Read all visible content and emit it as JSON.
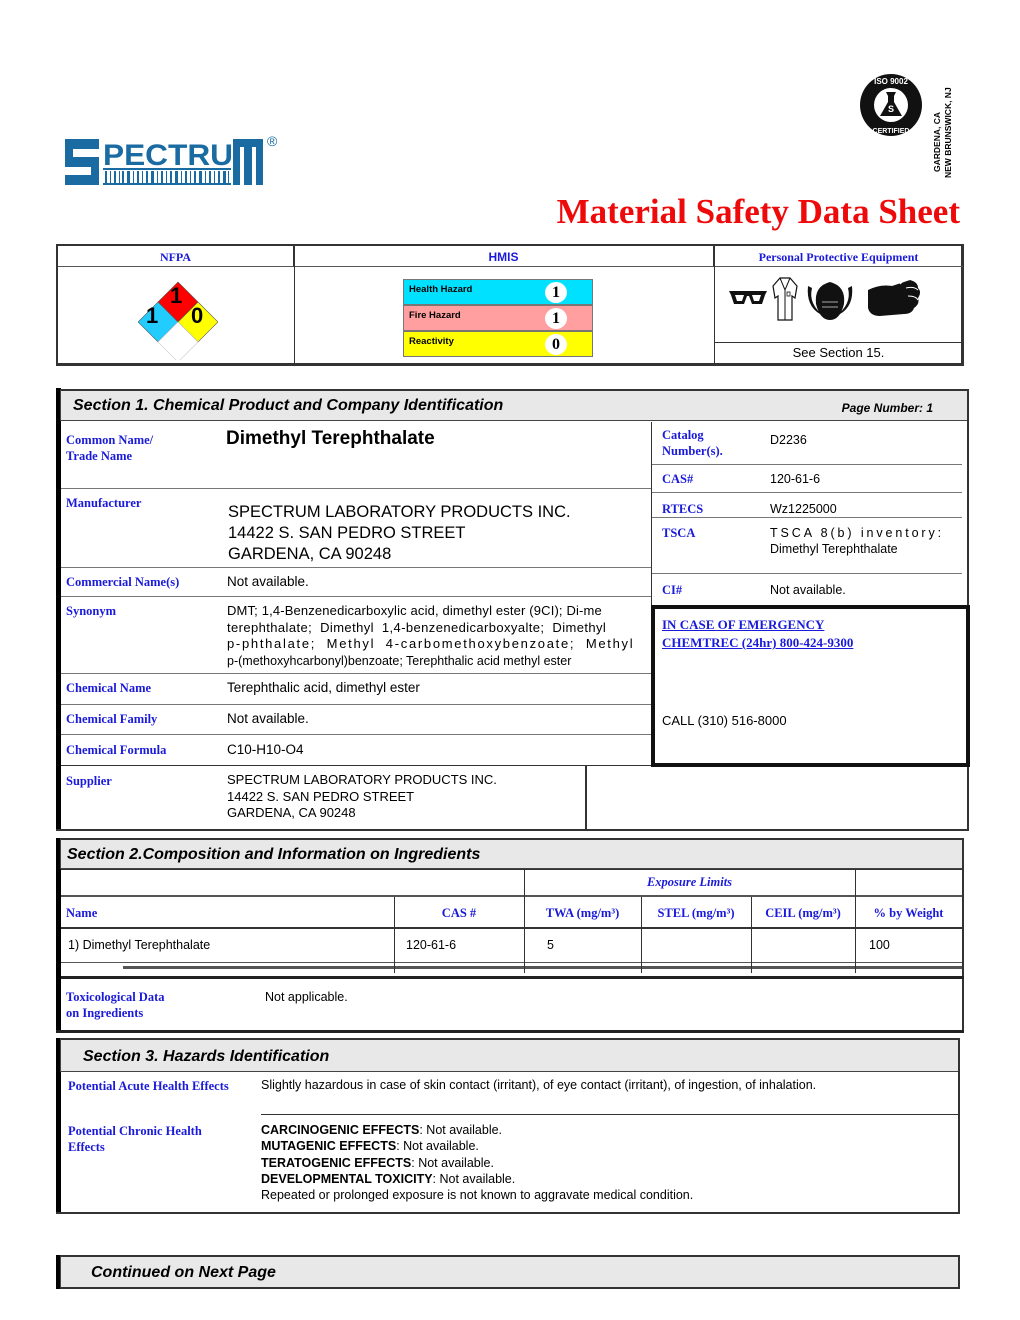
{
  "header": {
    "brand": "SPECTRUM",
    "registered_mark": "®",
    "iso_badge_text": "ISO 9002 CERTIFIED",
    "locations": [
      "GARDENA, CA",
      "NEW BRUNSWICK, NJ"
    ],
    "title": "Material Safety Data Sheet"
  },
  "hazard_table": {
    "nfpa_label": "NFPA",
    "hmis_label": "HMIS",
    "ppe_label": "Personal Protective Equipment",
    "nfpa": {
      "health": "1",
      "fire": "1",
      "reactivity": "0",
      "special": ""
    },
    "hmis": [
      {
        "label": "Health Hazard",
        "value": "1",
        "color": "#00e1ff"
      },
      {
        "label": "Fire Hazard",
        "value": "1",
        "color": "#ff9f9f"
      },
      {
        "label": "Reactivity",
        "value": "0",
        "color": "#ffff00"
      }
    ],
    "ppe_icons": [
      "safety-glasses-icon",
      "lab-coat-icon",
      "dust-respirator-icon",
      "gloves-icon"
    ],
    "ppe_note": "See Section 15."
  },
  "section1": {
    "title": "Section 1. Chemical Product and Company Identification",
    "page_number": "Page Number: 1",
    "common_name_label": "Common Name/\nTrade Name",
    "common_name": "Dimethyl Terephthalate",
    "manufacturer_label": "Manufacturer",
    "manufacturer": [
      "SPECTRUM LABORATORY PRODUCTS INC.",
      "14422 S. SAN PEDRO STREET",
      "GARDENA, CA 90248"
    ],
    "commercial_label": "Commercial Name(s)",
    "commercial": "Not available.",
    "synonym_label": "Synonym",
    "synonym": "DMT; 1,4-Benzenedicarboxylic acid, dimethyl ester (9CI); Di-methyl terephthalate; Dimethyl 1,4-benzenedicarboxyalte; Dimethyl p-phthalate; Methyl 4-carbomethoxybenzoate; Methyl p-(methoxyhcarbonyl)benzoate; Terephthalic acid methyl ester",
    "synonym_lines": [
      "DMT; 1,4-Benzenedicarboxylic acid, dimethyl ester (9CI); Di-me",
      "terephthalate;  Dimethyl  1,4-benzenedicarboxyalte;  Dimethyl",
      "p-phthalate;  Methyl  4-carbomethoxybenzoate;  Methyl",
      "p-(methoxyhcarbonyl)benzoate; Terephthalic acid methyl ester"
    ],
    "chem_name_label": "Chemical Name",
    "chem_name": "Terephthalic acid, dimethyl ester",
    "chem_family_label": "Chemical Family",
    "chem_family": "Not available.",
    "chem_formula_label": "Chemical Formula",
    "chem_formula": "C10-H10-O4",
    "supplier_label": "Supplier",
    "supplier": [
      "SPECTRUM LABORATORY PRODUCTS INC.",
      "14422 S. SAN PEDRO STREET",
      "GARDENA, CA 90248"
    ],
    "right": {
      "catalog_label": "Catalog\nNumber(s).",
      "catalog": "D2236",
      "cas_label": "CAS#",
      "cas": "120-61-6",
      "rtecs_label": "RTECS",
      "rtecs": "Wz1225000",
      "tsca_label": "TSCA",
      "tsca_line1": "TSCA 8(b) inventory:",
      "tsca_line2": "Dimethyl Terephthalate",
      "ci_label": "CI#",
      "ci": "Not available."
    },
    "emergency": {
      "line1": "IN CASE OF EMERGENCY",
      "line2": "CHEMTREC (24hr) 800-424-9300",
      "call": "CALL (310) 516-8000"
    }
  },
  "section2": {
    "title": "Section 2.Composition and Information on Ingredients",
    "exposure_limits_label": "Exposure Limits",
    "columns": [
      "Name",
      "CAS #",
      "TWA (mg/m³)",
      "STEL (mg/m³)",
      "CEIL (mg/m³)",
      "% by Weight"
    ],
    "rows": [
      {
        "name": "1) Dimethyl Terephthalate",
        "cas": "120-61-6",
        "twa": "5",
        "stel": "",
        "ceil": "",
        "weight": "100"
      }
    ],
    "tox_label": "Toxicological Data\non Ingredients",
    "tox_value": "Not applicable."
  },
  "section3": {
    "title": "Section 3. Hazards Identification",
    "acute_label": "Potential Acute Health Effects",
    "acute_value": "Slightly hazardous in case of skin contact (irritant), of eye contact (irritant), of ingestion, of inhalation.",
    "chronic_label": "Potential Chronic Health\nEffects",
    "chronic_items": [
      {
        "key": "CARCINOGENIC EFFECTS",
        "value": ": Not available."
      },
      {
        "key": "MUTAGENIC EFFECTS",
        "value": ": Not available."
      },
      {
        "key": "TERATOGENIC EFFECTS",
        "value": ": Not available."
      },
      {
        "key": "DEVELOPMENTAL TOXICITY",
        "value": ": Not available."
      }
    ],
    "chronic_note": "Repeated or prolonged exposure is not known to aggravate medical condition."
  },
  "footer": {
    "continued": "Continued on Next Page"
  }
}
